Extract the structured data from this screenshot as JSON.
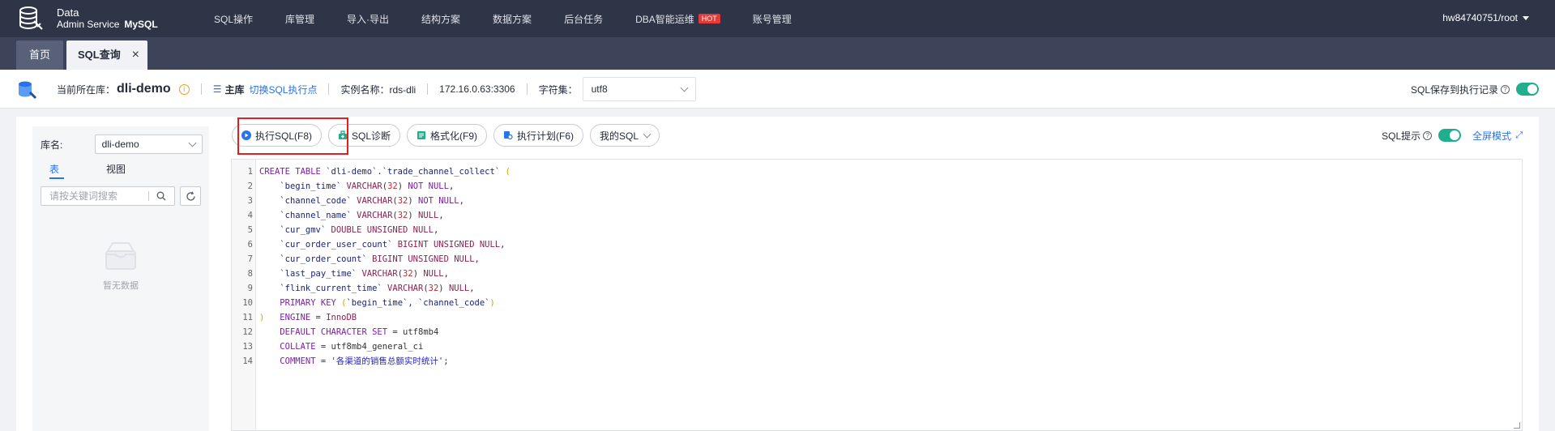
{
  "brand": {
    "title": "Data",
    "subtitle": "Admin Service",
    "engine": "MySQL"
  },
  "nav": {
    "items": [
      "SQL操作",
      "库管理",
      "导入·导出",
      "结构方案",
      "数据方案",
      "后台任务",
      "DBA智能运维",
      "账号管理"
    ],
    "hot_badge": "HOT",
    "user": "hw84740751/root"
  },
  "tabs": {
    "home": "首页",
    "sql_query": "SQL查询"
  },
  "info": {
    "current_db_label": "当前所在库：",
    "current_db": "dli-demo",
    "master_label": "主库",
    "switch_link": "切换SQL执行点",
    "instance": "实例名称：rds-dli",
    "address": "172.16.0.63:3306",
    "charset_label": "字符集：",
    "charset_value": "utf8",
    "save_history_label": "SQL保存到执行记录"
  },
  "left_panel": {
    "db_label": "库名:",
    "db_value": "dli-demo",
    "tab_table": "表",
    "tab_view": "视图",
    "search_placeholder": "请按关键词搜索",
    "empty_text": "暂无数据"
  },
  "toolbar": {
    "execute": "执行SQL(F8)",
    "diagnose": "SQL诊断",
    "format": "格式化(F9)",
    "plan": "执行计划(F6)",
    "my_sql": "我的SQL",
    "sql_hint": "SQL提示",
    "fullscreen": "全屏模式"
  },
  "colors": {
    "accent": "#2a72e8",
    "toggle": "#21ae8e",
    "highlight": "#e02020",
    "nav_bg": "#2e3547"
  },
  "editor": {
    "lines": [
      "1",
      "2",
      "3",
      "4",
      "5",
      "6",
      "7",
      "8",
      "9",
      "10",
      "11",
      "12",
      "13",
      "14"
    ],
    "code": {
      "l1_kw": "CREATE TABLE",
      "l1_name": " `dli-demo`.`trade_channel_collect` ",
      "l1_par": "(",
      "l2_col": "`begin_time`",
      "l2_type": " VARCHAR",
      "l2_num": "32",
      "l2_kw": " NOT NULL",
      "l3_col": "`channel_code`",
      "l3_type": " VARCHAR",
      "l3_num": "32",
      "l3_kw": " NOT NULL",
      "l4_col": "`channel_name`",
      "l4_type": " VARCHAR",
      "l4_num": "32",
      "l4_kw": " NULL",
      "l5_col": "`cur_gmv`",
      "l5_type": " DOUBLE UNSIGNED NULL",
      "l6_col": "`cur_order_user_count`",
      "l6_type": " BIGINT UNSIGNED NULL",
      "l7_col": "`cur_order_count`",
      "l7_type": " BIGINT UNSIGNED NULL",
      "l8_col": "`last_pay_time`",
      "l8_type": " VARCHAR",
      "l8_num": "32",
      "l8_kw": " NULL",
      "l9_col": "`flink_current_time`",
      "l9_type": " VARCHAR",
      "l9_num": "32",
      "l9_kw": " NULL",
      "l10_kw": "PRIMARY KEY ",
      "l10_cols": "`begin_time`, `channel_code`",
      "l11_kw": "ENGINE",
      "l11_val": "InnoDB",
      "l12_kw": "DEFAULT CHARACTER SET",
      "l12_val": "utf8mb4",
      "l13_kw": "COLLATE",
      "l13_val": "utf8mb4_general_ci",
      "l14_kw": "COMMENT",
      "l14_str": "'各渠道的销售总额实时统计'"
    }
  }
}
